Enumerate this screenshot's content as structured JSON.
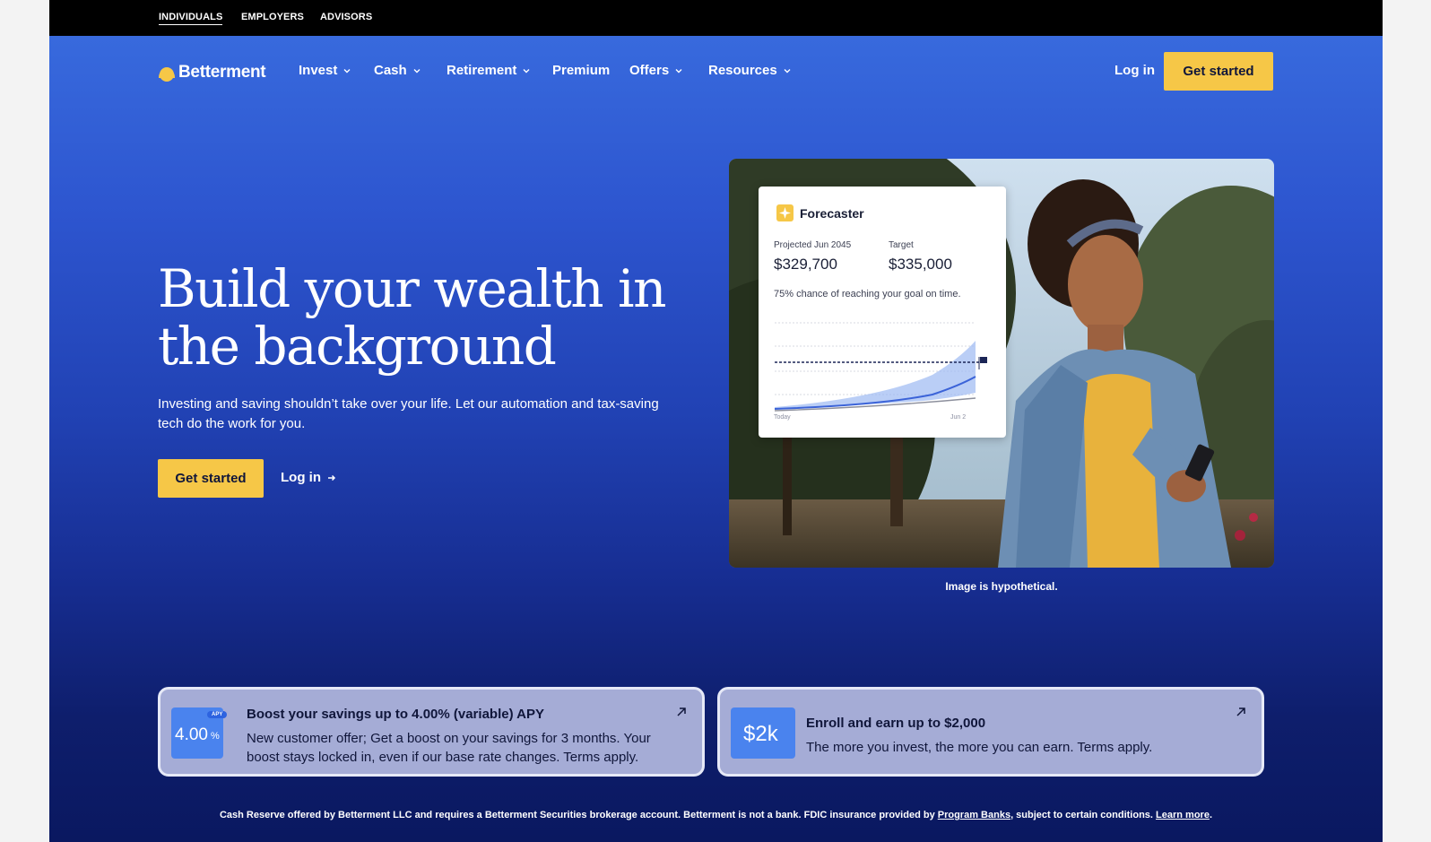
{
  "audience_tabs": [
    "INDIVIDUALS",
    "EMPLOYERS",
    "ADVISORS"
  ],
  "brand": {
    "name": "Betterment",
    "accent": "#f6c747",
    "hero_blue": "#2d55cf",
    "navy": "#0a1860"
  },
  "nav": {
    "items": [
      "Invest",
      "Cash",
      "Retirement",
      "Premium",
      "Offers",
      "Resources"
    ],
    "login": "Log in",
    "cta": "Get started"
  },
  "hero": {
    "title_line1": "Build your wealth in",
    "title_line2": "the background",
    "subtitle": "Investing and saving shouldn’t take over your life. Let our automation and tax-saving tech do the work for you.",
    "cta": "Get started",
    "login": "Log in"
  },
  "forecaster": {
    "title": "Forecaster",
    "projected_label": "Projected Jun 2045",
    "projected_value": "$329,700",
    "target_label": "Target",
    "target_value": "$335,000",
    "note": "75% chance of reaching your goal on time.",
    "x_start": "Today",
    "x_end": "Jun 2"
  },
  "image_caption": "Image is hypothetical.",
  "promos": [
    {
      "badge_value": "4.00",
      "badge_unit": "%",
      "badge_tag": "APY",
      "title": "Boost your savings up to 4.00% (variable) APY",
      "body_line1": "New customer offer; Get a boost on your savings for 3 months. Your",
      "body_line2": "boost stays locked in, even if our base rate changes. Terms apply."
    },
    {
      "badge_value": "$2k",
      "title": "Enroll and earn up to $2,000",
      "body": "The more you invest, the more you can earn. Terms apply."
    }
  ],
  "disclaimer": {
    "text_before": "Cash Reserve offered by Betterment LLC and requires a Betterment Securities brokerage account. Betterment is not a bank. FDIC insurance provided by ",
    "link1": "Program Banks",
    "text_middle": ", subject to certain conditions. ",
    "link2": "Learn more",
    "text_after": "."
  }
}
